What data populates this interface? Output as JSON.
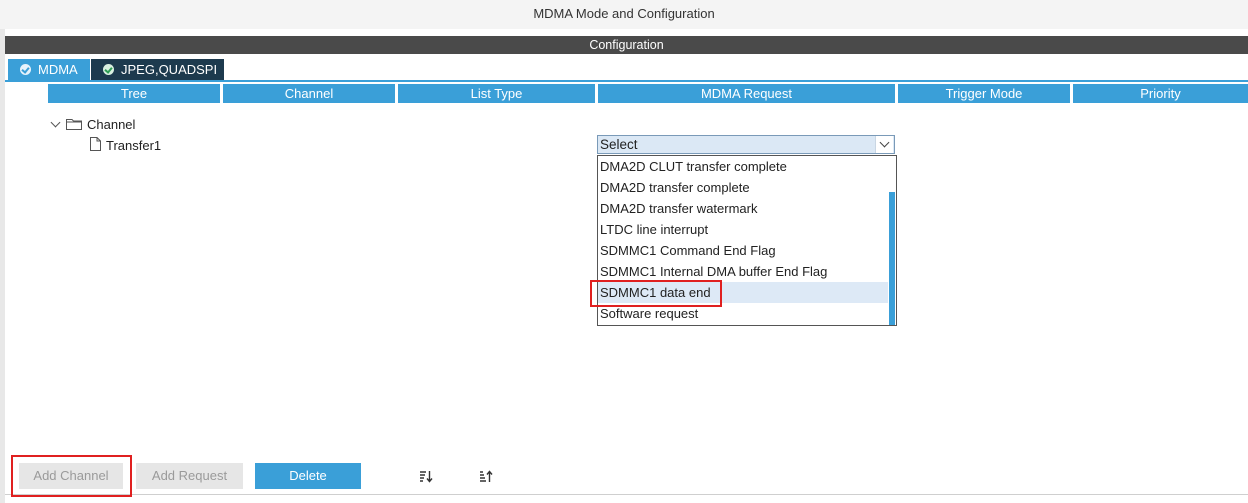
{
  "window": {
    "title": "MDMA Mode and Configuration"
  },
  "configuration": {
    "header": "Configuration",
    "tabs": [
      {
        "label": "MDMA",
        "status_icon": "check-circle-icon",
        "active": true
      },
      {
        "label": "JPEG,QUADSPI",
        "status_icon": "check-circle-icon",
        "active": false
      }
    ]
  },
  "table": {
    "columns": [
      "Tree",
      "Channel",
      "List Type",
      "MDMA Request",
      "Trigger Mode",
      "Priority"
    ],
    "tree": {
      "channel_label": "Channel",
      "transfer_label": "Transfer1"
    }
  },
  "mdma_request": {
    "selected": "Select",
    "options": [
      "DMA2D CLUT transfer complete",
      "DMA2D transfer complete",
      "DMA2D transfer watermark",
      "LTDC line interrupt",
      "SDMMC1 Command End Flag",
      "SDMMC1 Internal DMA buffer End Flag",
      "SDMMC1 data end",
      "Software request"
    ],
    "highlighted": "SDMMC1 data end"
  },
  "buttons": {
    "add_channel": "Add Channel",
    "add_request": "Add Request",
    "delete": "Delete"
  },
  "icons": {
    "sort_down": "sort-down-icon",
    "sort_up": "sort-up-icon"
  },
  "colors": {
    "accent": "#3a9fd8",
    "header_dark": "#4a4a4a",
    "tab_dark": "#1d3a4e",
    "annotation_red": "#e02020"
  }
}
